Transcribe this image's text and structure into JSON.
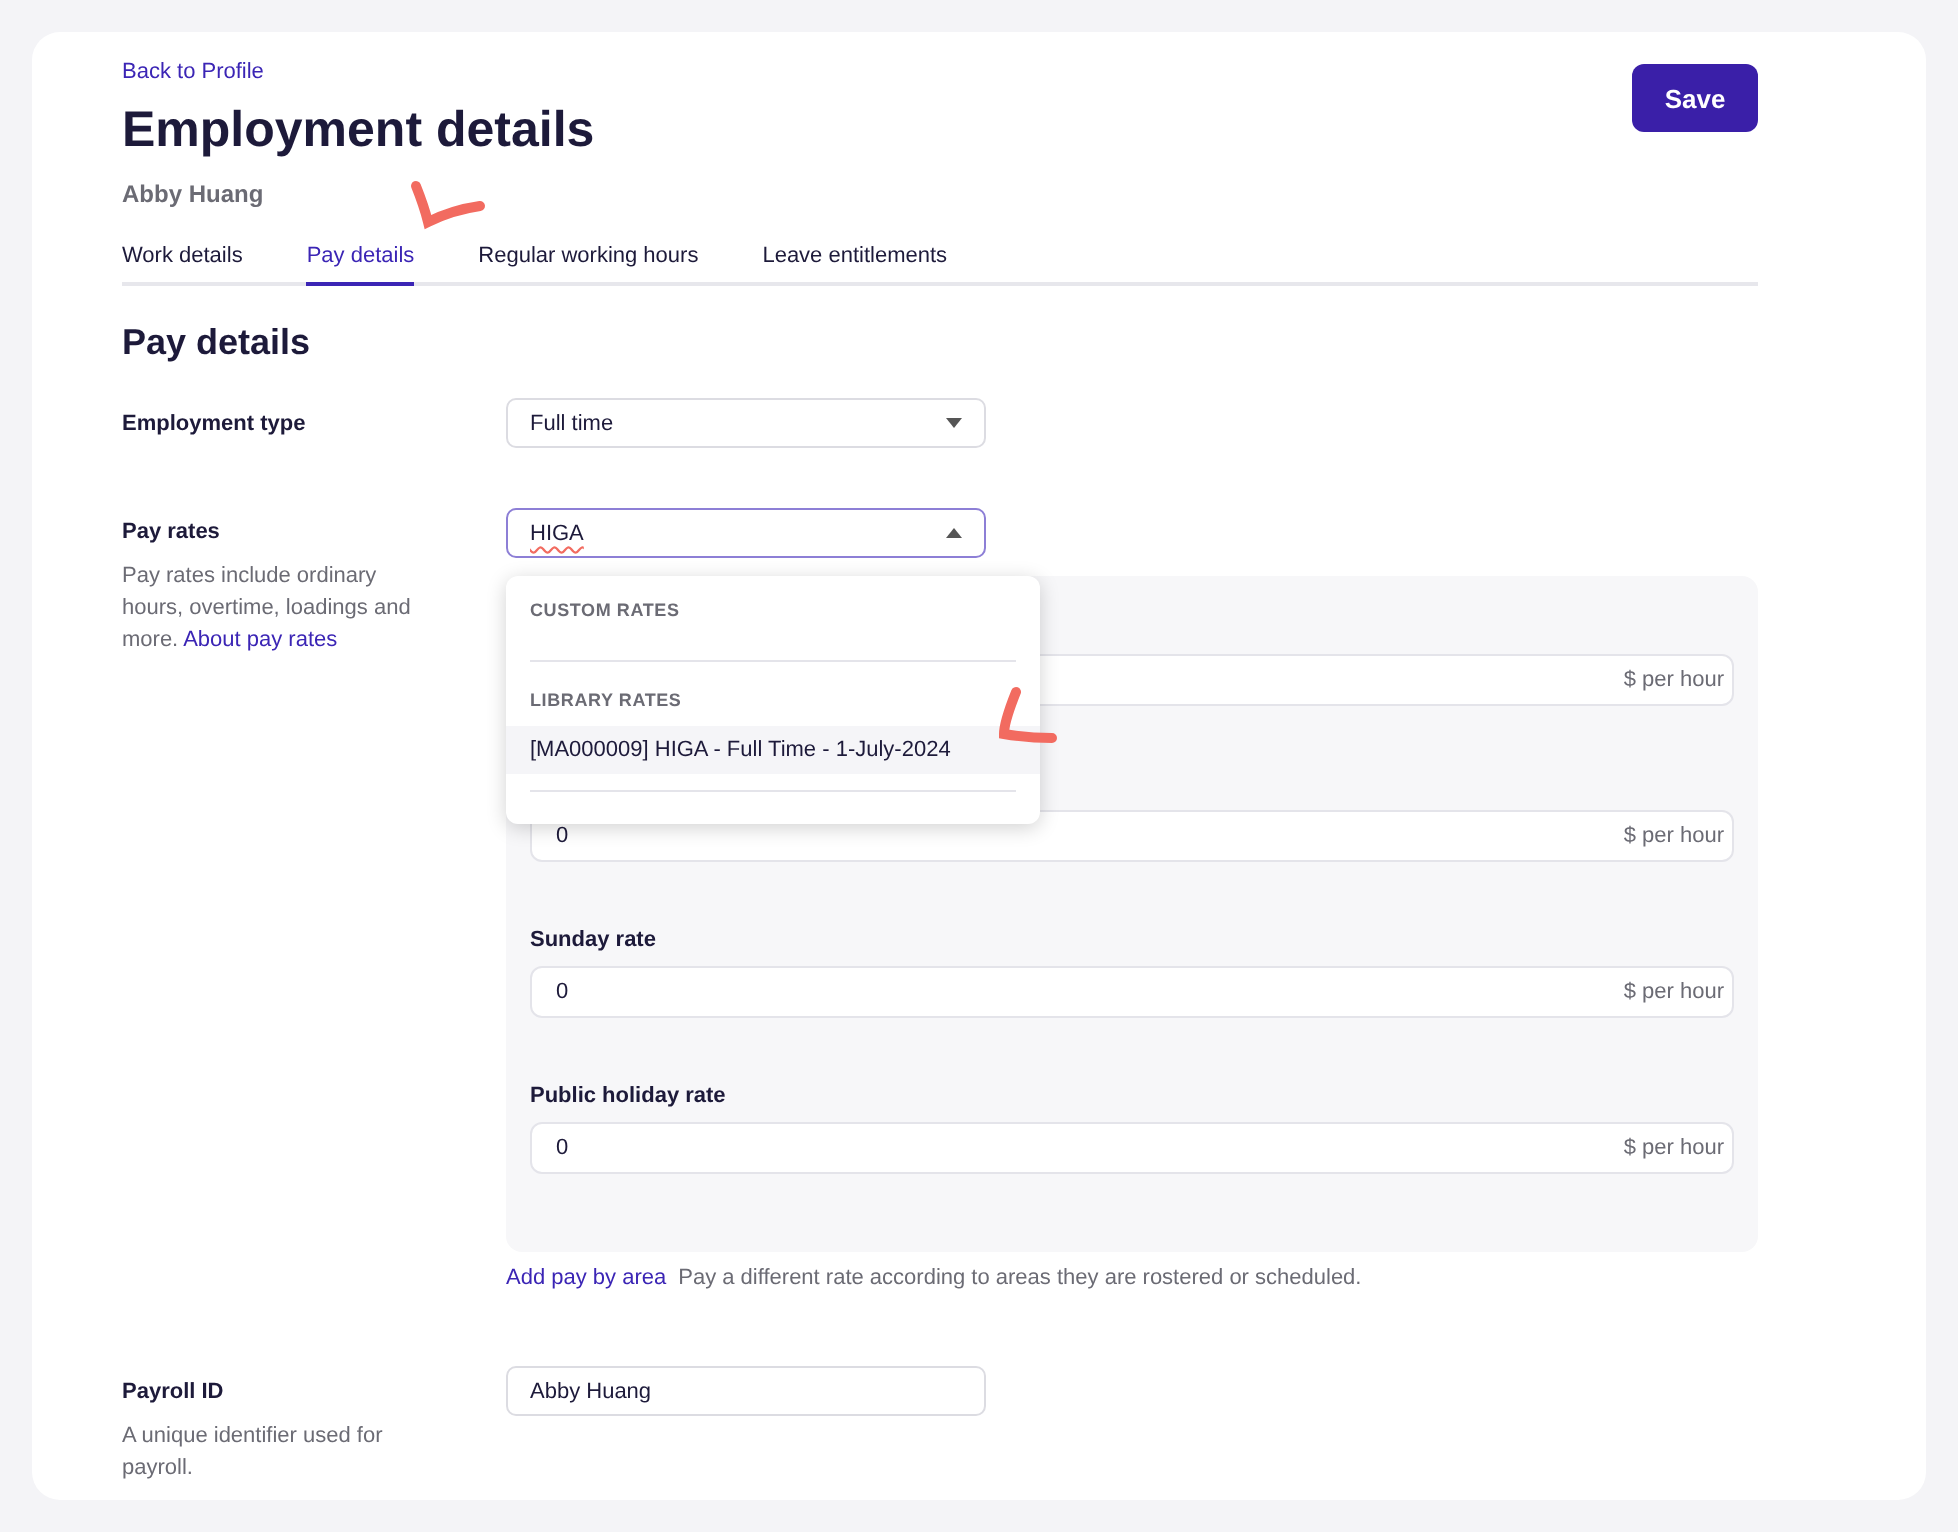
{
  "back_link": "Back to Profile",
  "title": "Employment details",
  "subtitle": "Abby Huang",
  "save_button": "Save",
  "tabs": [
    {
      "label": "Work details",
      "selected": false
    },
    {
      "label": "Pay details",
      "selected": true
    },
    {
      "label": "Regular working hours",
      "selected": false
    },
    {
      "label": "Leave entitlements",
      "selected": false
    }
  ],
  "section_title": "Pay details",
  "employment_type": {
    "label": "Employment type",
    "value": "Full time"
  },
  "pay_rates": {
    "label": "Pay rates",
    "description": "Pay rates include ordinary hours, overtime, loadings and more.",
    "link": "About pay rates",
    "value": "HIGA",
    "expanded": true,
    "dropdown": [
      {
        "heading": "CUSTOM RATES"
      },
      {
        "heading": "LIBRARY RATES",
        "options": [
          {
            "label": "[MA000009] HIGA - Full Time - 1-July-2024",
            "highlighted": true
          }
        ]
      }
    ],
    "rates": [
      {
        "unit": "$ per hour"
      },
      {
        "value": "0",
        "unit": "$ per hour"
      },
      {
        "label": "Sunday rate",
        "value": "0",
        "unit": "$ per hour"
      },
      {
        "label": "Public holiday rate",
        "value": "0",
        "unit": "$ per hour"
      }
    ],
    "area_link": "Add pay by area",
    "area_note": "Pay a different rate according to areas they are rostered or scheduled."
  },
  "payroll_id": {
    "label": "Payroll ID",
    "description": "A unique identifier used for payroll.",
    "value": "Abby Huang"
  }
}
